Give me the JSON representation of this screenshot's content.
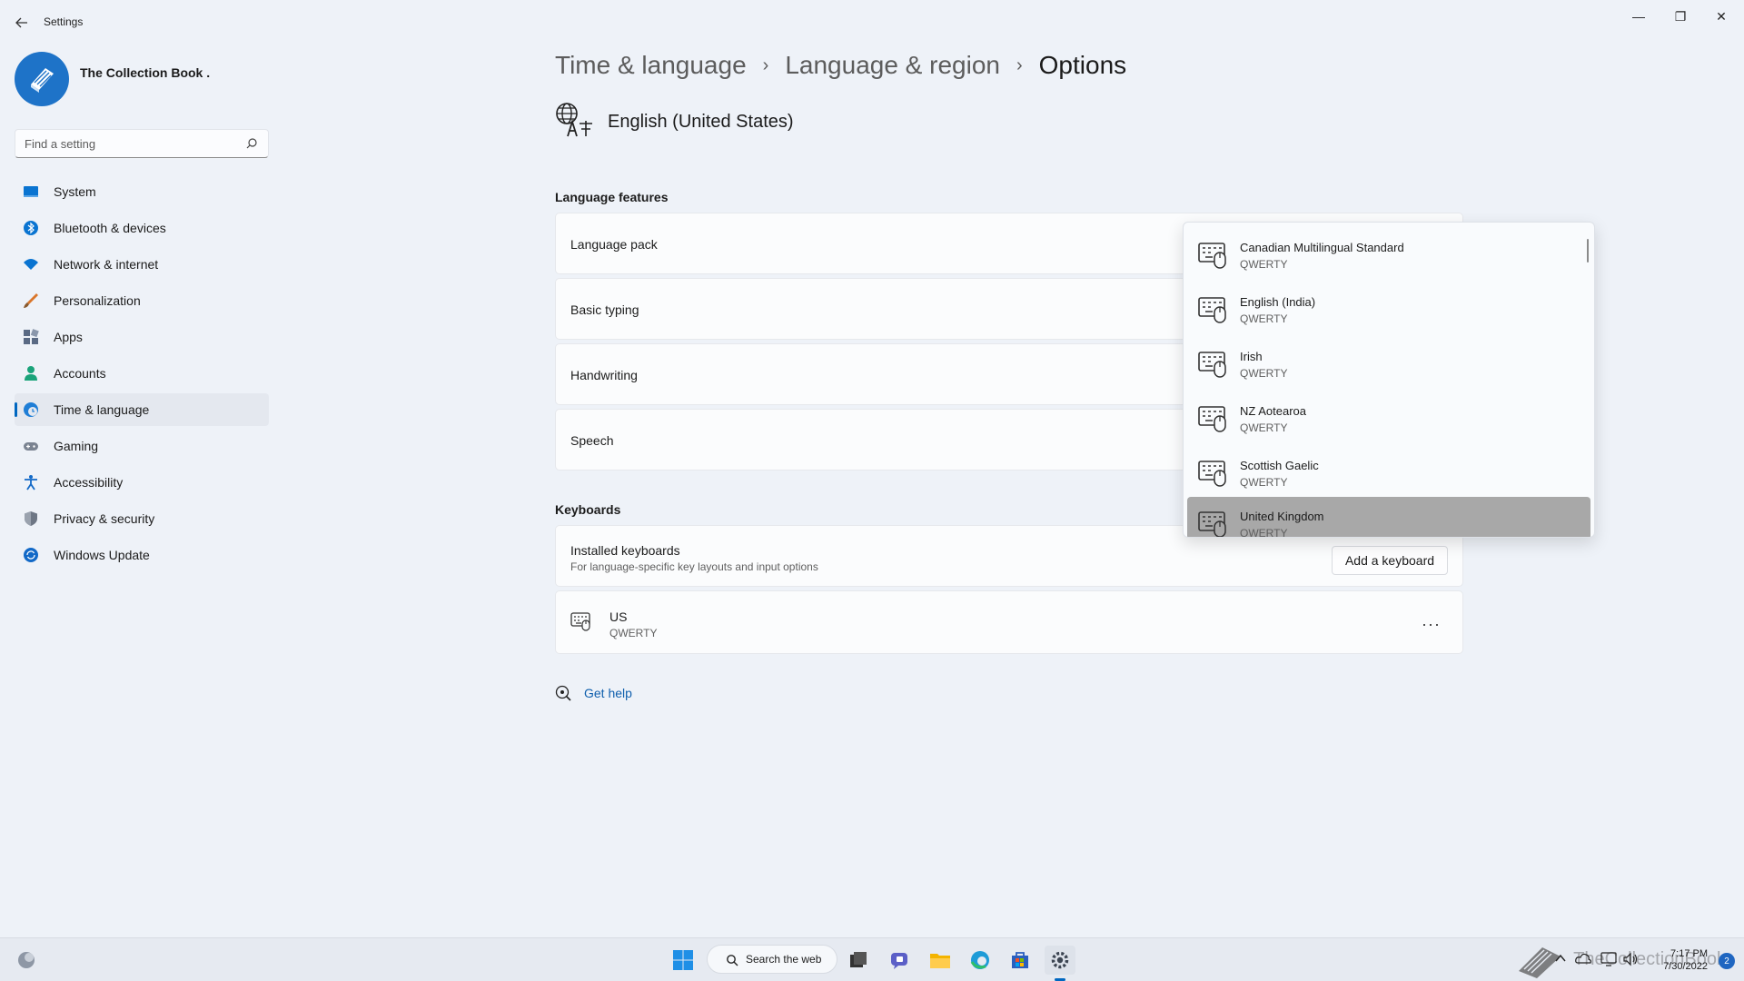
{
  "window": {
    "title": "Settings",
    "minimize": "—",
    "maximize": "❐",
    "close": "✕"
  },
  "profile": {
    "name": "The Collection Book ."
  },
  "search": {
    "placeholder": "Find a setting"
  },
  "sidebar": {
    "items": [
      {
        "label": "System",
        "icon": "monitor-icon",
        "color": "#0a74d1"
      },
      {
        "label": "Bluetooth & devices",
        "icon": "bluetooth-icon",
        "color": "#0a74d1"
      },
      {
        "label": "Network & internet",
        "icon": "wifi-icon",
        "color": "#0a74d1"
      },
      {
        "label": "Personalization",
        "icon": "brush-icon",
        "color": "#d9762b"
      },
      {
        "label": "Apps",
        "icon": "apps-icon",
        "color": "#5a6a84"
      },
      {
        "label": "Accounts",
        "icon": "person-icon",
        "color": "#1aa37a"
      },
      {
        "label": "Time & language",
        "icon": "globe-clock-icon",
        "color": "#1f7ed6",
        "active": true
      },
      {
        "label": "Gaming",
        "icon": "gamepad-icon",
        "color": "#7a8391"
      },
      {
        "label": "Accessibility",
        "icon": "accessibility-icon",
        "color": "#1269c7"
      },
      {
        "label": "Privacy & security",
        "icon": "shield-icon",
        "color": "#6e7785"
      },
      {
        "label": "Windows Update",
        "icon": "update-icon",
        "color": "#1269c7"
      }
    ]
  },
  "breadcrumb": {
    "part1": "Time & language",
    "part2": "Language & region",
    "current": "Options",
    "separator": "›"
  },
  "language": {
    "name": "English (United States)"
  },
  "features": {
    "heading": "Language features",
    "items": [
      {
        "label": "Language pack"
      },
      {
        "label": "Basic typing"
      },
      {
        "label": "Handwriting"
      },
      {
        "label": "Speech"
      }
    ]
  },
  "keyboards": {
    "heading": "Keyboards",
    "installed_label": "Installed keyboards",
    "installed_sub": "For language-specific key layouts and input options",
    "add_button": "Add a keyboard",
    "current": {
      "name": "US",
      "layout": "QWERTY"
    },
    "more": "···"
  },
  "help": {
    "label": "Get help"
  },
  "dropdown": {
    "items": [
      {
        "name": "Canadian Multilingual Standard",
        "layout": "QWERTY"
      },
      {
        "name": "English (India)",
        "layout": "QWERTY"
      },
      {
        "name": "Irish",
        "layout": "QWERTY"
      },
      {
        "name": "NZ Aotearoa",
        "layout": "QWERTY"
      },
      {
        "name": "Scottish Gaelic",
        "layout": "QWERTY"
      },
      {
        "name": "United Kingdom",
        "layout": "QWERTY",
        "selected": true
      }
    ]
  },
  "taskbar": {
    "search_label": "Search the web",
    "time": "7:17 PM",
    "date": "7/30/2022",
    "notifications": "2",
    "watermark": "TheCollectionBook"
  },
  "colors": {
    "accent": "#0067c0",
    "link": "#0f5fad"
  }
}
